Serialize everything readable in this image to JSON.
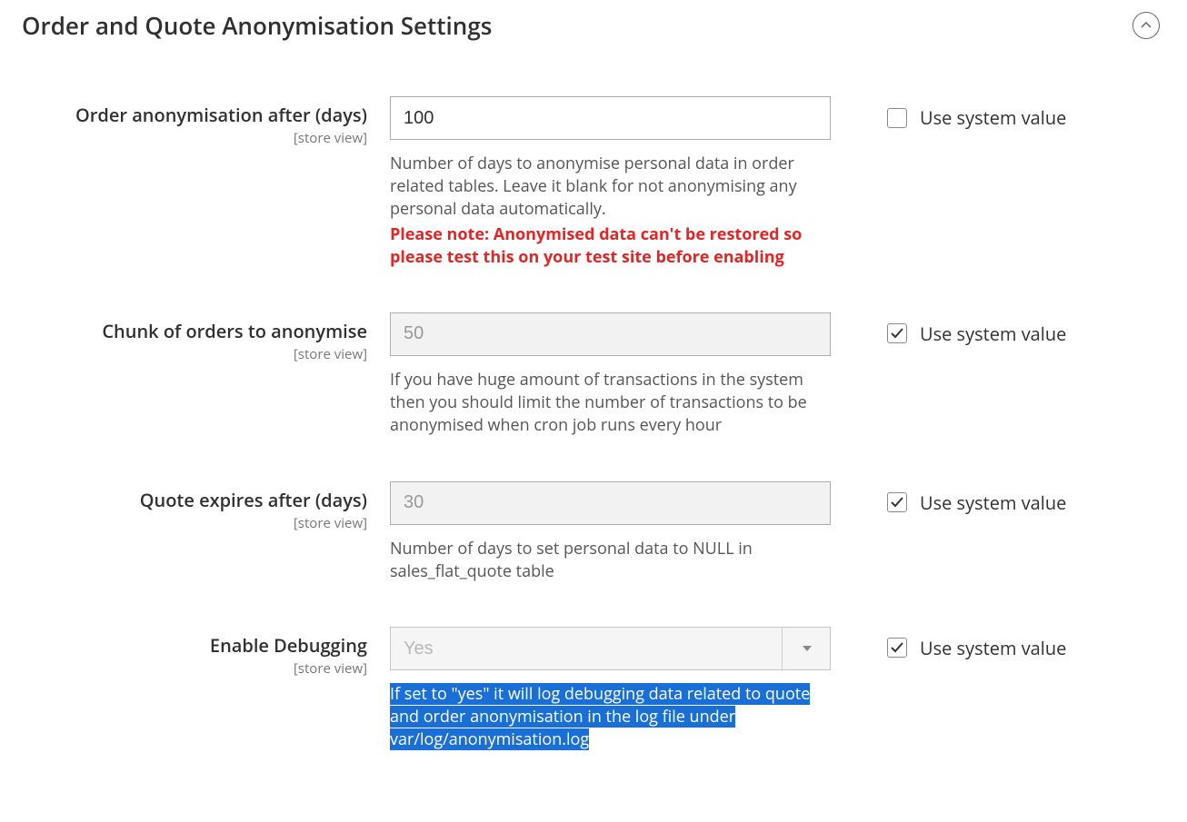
{
  "section": {
    "title": "Order and Quote Anonymisation Settings"
  },
  "scope_label": "[store view]",
  "system_value_label": "Use system value",
  "fields": {
    "order_anon": {
      "label": "Order anonymisation after (days)",
      "value": "100",
      "help": "Number of days to anonymise personal data in order related tables. Leave it blank for not anonymising any personal data automatically.",
      "warning": "Please note: Anonymised data can't be restored so please test this on your test site before enabling",
      "use_system": false
    },
    "chunk": {
      "label": "Chunk of orders to anonymise",
      "value": "50",
      "help": "If you have huge amount of transactions in the system then you should limit the number of transactions to be anonymised when cron job runs every hour",
      "use_system": true
    },
    "quote_expires": {
      "label": "Quote expires after (days)",
      "value": "30",
      "help": "Number of days to set personal data to NULL in sales_flat_quote table",
      "use_system": true
    },
    "debugging": {
      "label": "Enable Debugging",
      "value": "Yes",
      "help": "If set to \"yes\" it will log debugging data related to quote and order anonymisation in the log file under var/log/anonymisation.log",
      "use_system": true
    }
  }
}
